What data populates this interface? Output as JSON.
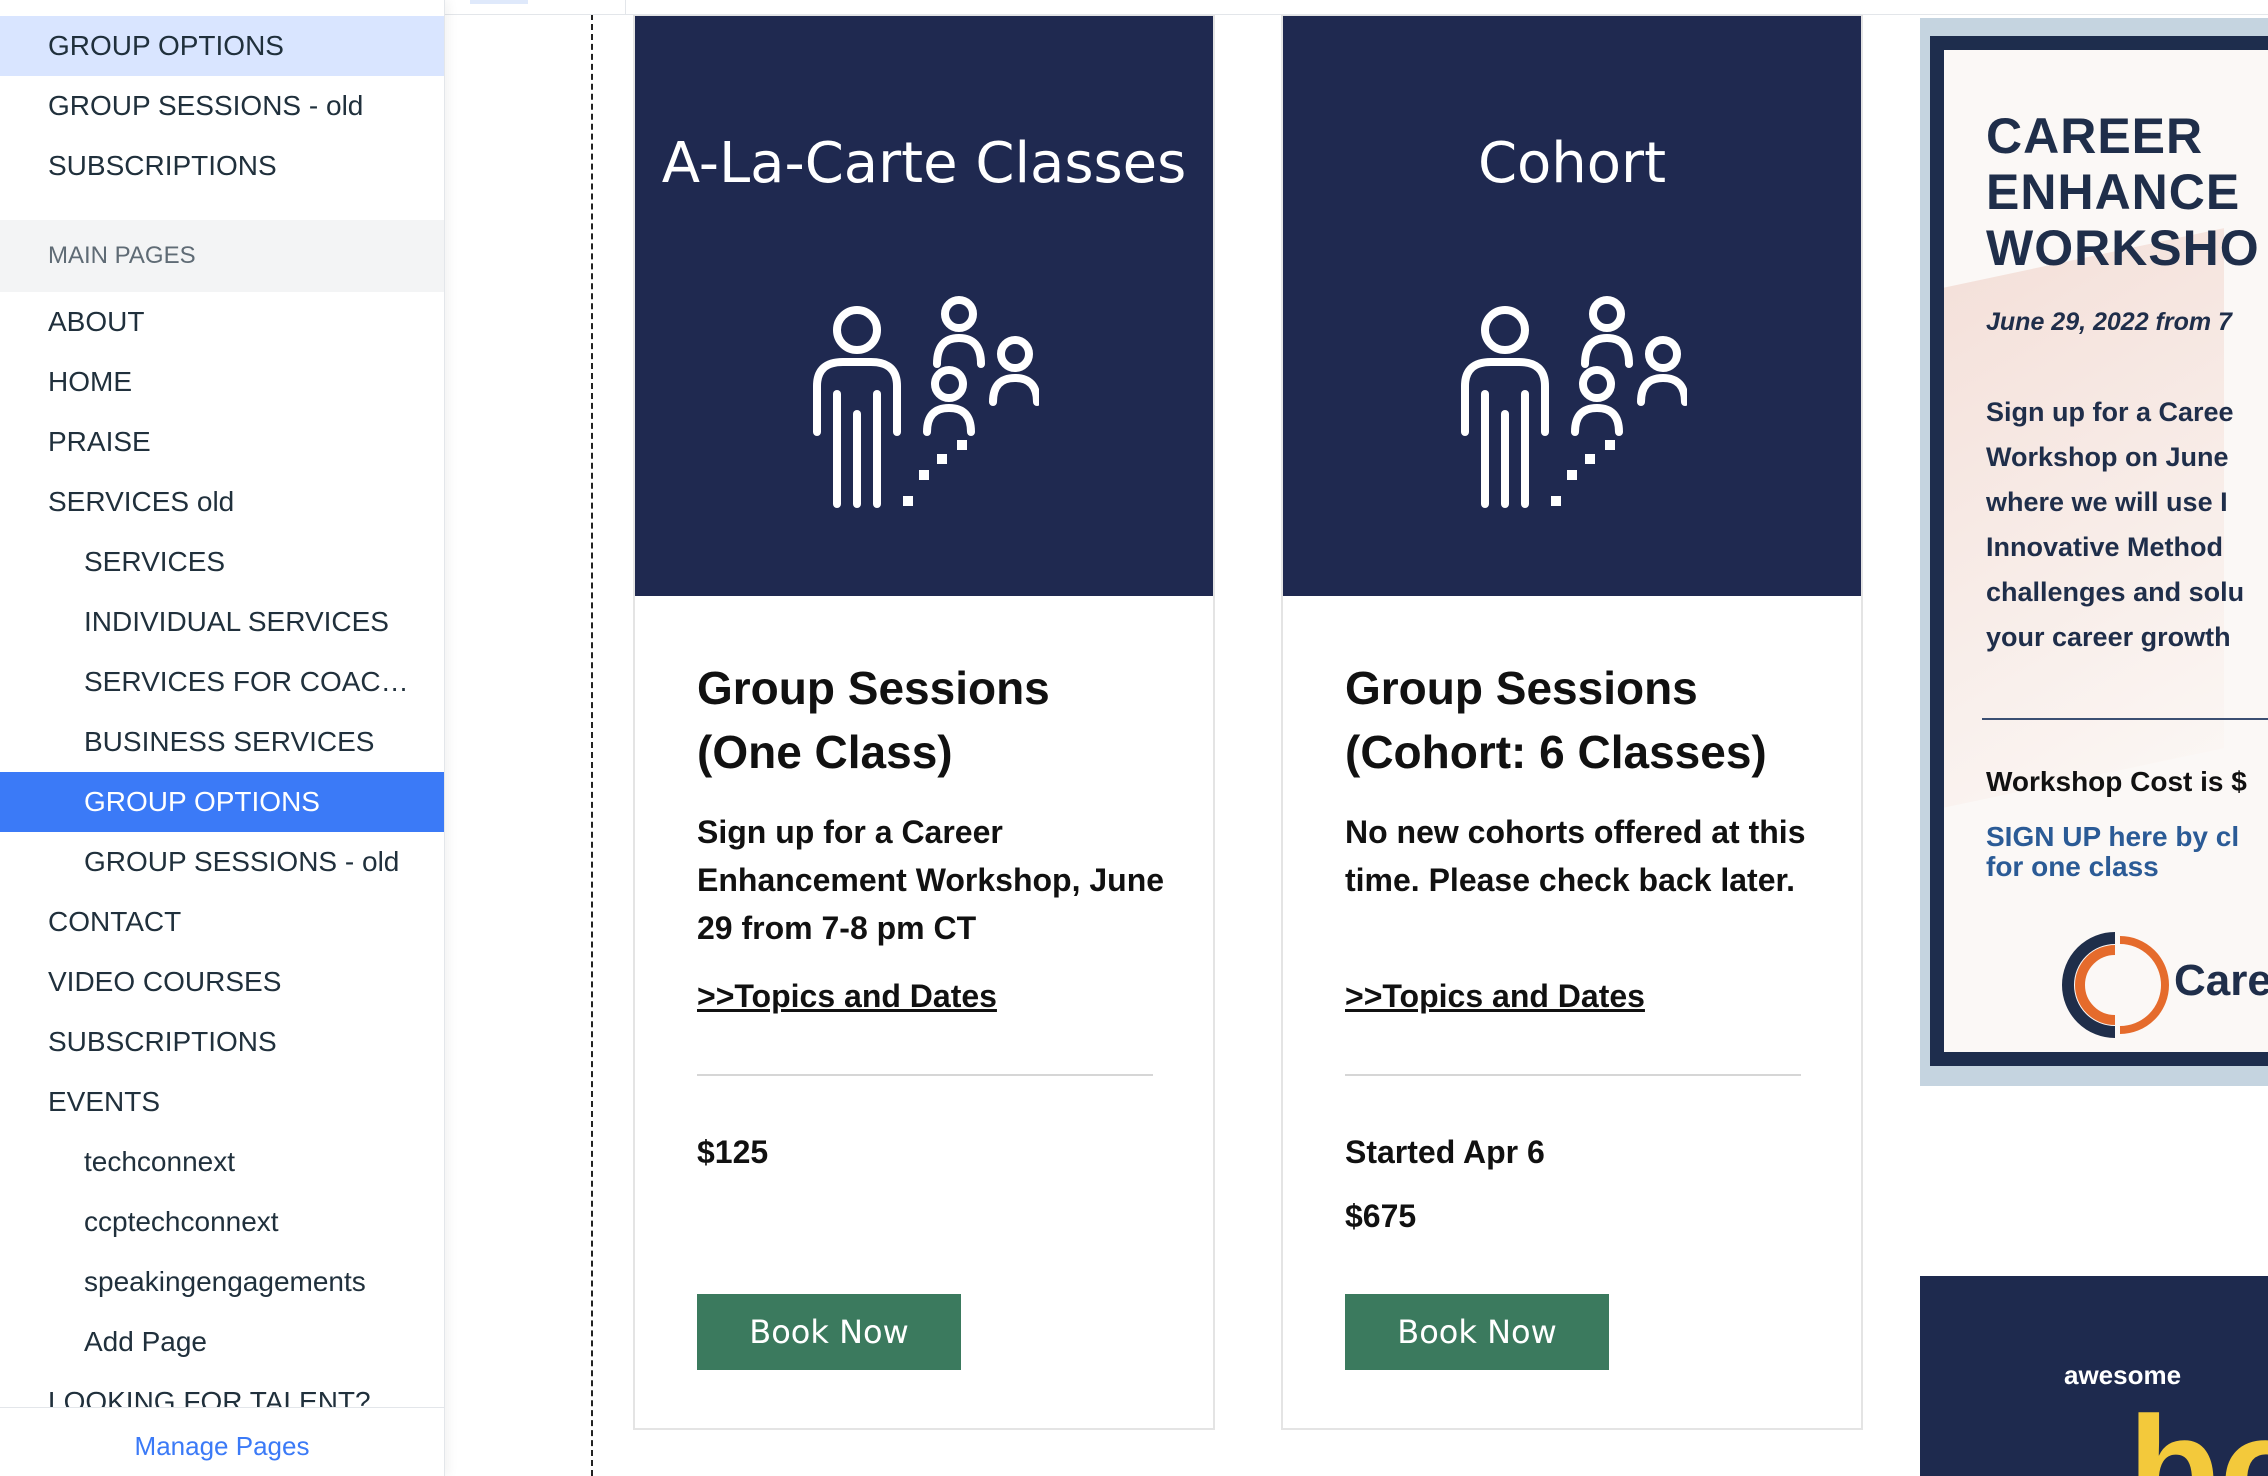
{
  "sidebar": {
    "items": [
      {
        "label": "GROUP OPTIONS",
        "level": 0,
        "state": "hover"
      },
      {
        "label": "GROUP SESSIONS - old",
        "level": 0
      },
      {
        "label": "SUBSCRIPTIONS",
        "level": 0
      }
    ],
    "section_header": "MAIN PAGES",
    "main_items": [
      {
        "label": "ABOUT",
        "level": 0
      },
      {
        "label": "HOME",
        "level": 0
      },
      {
        "label": "PRAISE",
        "level": 0
      },
      {
        "label": "SERVICES old",
        "level": 0
      },
      {
        "label": "SERVICES",
        "level": 1
      },
      {
        "label": "INDIVIDUAL SERVICES",
        "level": 1
      },
      {
        "label": "SERVICES FOR COAC…",
        "level": 1
      },
      {
        "label": "BUSINESS SERVICES",
        "level": 1
      },
      {
        "label": "GROUP OPTIONS",
        "level": 1,
        "state": "selected"
      },
      {
        "label": "GROUP SESSIONS - old",
        "level": 1
      },
      {
        "label": "CONTACT",
        "level": 0
      },
      {
        "label": "VIDEO COURSES",
        "level": 0
      },
      {
        "label": "SUBSCRIPTIONS",
        "level": 0
      },
      {
        "label": "EVENTS",
        "level": 0
      },
      {
        "label": "techconnext",
        "level": 1
      },
      {
        "label": "ccptechconnext",
        "level": 1
      },
      {
        "label": "speakingengagements",
        "level": 1
      },
      {
        "label": "Add Page",
        "level": 1
      },
      {
        "label": "LOOKING FOR TALENT?",
        "level": 0
      }
    ],
    "manage_pages": "Manage Pages"
  },
  "cards": [
    {
      "banner_title": "A-La-Carte Classes",
      "icon": "group-people-icon",
      "heading_line1": "Group Sessions",
      "heading_line2": "(One Class)",
      "description": "Sign up for a Career Enhancement Workshop, June 29 from 7-8 pm CT",
      "link": ">>Topics and Dates",
      "price_line1": "$125",
      "price_line2": "",
      "button": "Book Now"
    },
    {
      "banner_title": "Cohort",
      "icon": "group-people-icon",
      "heading_line1": "Group Sessions",
      "heading_line2": "(Cohort: 6 Classes)",
      "description": "No new cohorts offered at this time. Please check back later.",
      "link": ">>Topics and Dates",
      "price_line1": "Started Apr 6",
      "price_line2": "$675",
      "button": "Book Now"
    }
  ],
  "flyer": {
    "title_line1": "CAREER",
    "title_line2": "ENHANCE",
    "title_line3": "WORKSHO",
    "date": "June 29, 2022 from 7",
    "body_lines": [
      "Sign up for a Caree",
      "Workshop on June",
      "where we will use I",
      "Innovative Method",
      "challenges and solu",
      "your career growth"
    ],
    "cost": "Workshop Cost is $",
    "signup_line1": "SIGN UP here by cl",
    "signup_line2": "for one class",
    "logo_text": "Care"
  },
  "promo": {
    "small_text": "awesome",
    "big_text": "bo"
  },
  "colors": {
    "accent_blue": "#3b7af7",
    "hover_blue": "#d9e5ff",
    "navy": "#1f2950",
    "button_green": "#3b7a5e",
    "flyer_navy": "#1f2e4a",
    "promo_yellow": "#f3c93b"
  }
}
